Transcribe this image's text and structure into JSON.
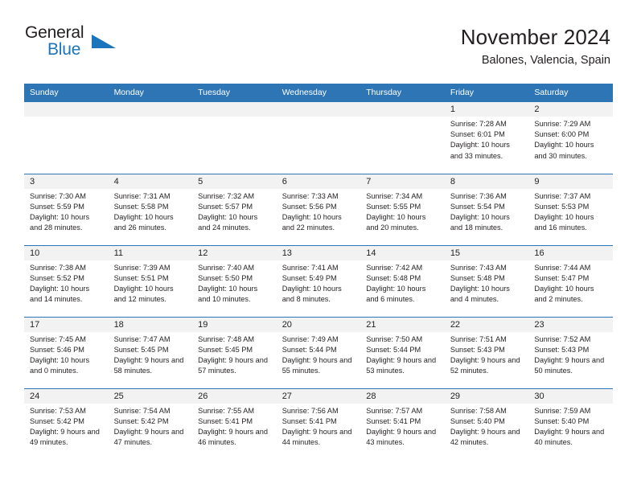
{
  "brand": {
    "name_top": "General",
    "name_bottom": "Blue",
    "accent_color": "#1c75bc",
    "triangle_icon": "triangle-icon"
  },
  "header": {
    "title": "November 2024",
    "location": "Balones, Valencia, Spain"
  },
  "theme": {
    "header_blue": "#2e75b6",
    "daynum_gray": "#f2f2f2",
    "text": "#231f20"
  },
  "weekday_headers": [
    "Sunday",
    "Monday",
    "Tuesday",
    "Wednesday",
    "Thursday",
    "Friday",
    "Saturday"
  ],
  "labels": {
    "sunrise": "Sunrise:",
    "sunset": "Sunset:",
    "daylight": "Daylight:"
  },
  "weeks": [
    [
      {
        "day": "",
        "blank": true
      },
      {
        "day": "",
        "blank": true
      },
      {
        "day": "",
        "blank": true
      },
      {
        "day": "",
        "blank": true
      },
      {
        "day": "",
        "blank": true
      },
      {
        "day": "1",
        "sunrise": "Sunrise: 7:28 AM",
        "sunset": "Sunset: 6:01 PM",
        "daylight": "Daylight: 10 hours and 33 minutes."
      },
      {
        "day": "2",
        "sunrise": "Sunrise: 7:29 AM",
        "sunset": "Sunset: 6:00 PM",
        "daylight": "Daylight: 10 hours and 30 minutes."
      }
    ],
    [
      {
        "day": "3",
        "sunrise": "Sunrise: 7:30 AM",
        "sunset": "Sunset: 5:59 PM",
        "daylight": "Daylight: 10 hours and 28 minutes."
      },
      {
        "day": "4",
        "sunrise": "Sunrise: 7:31 AM",
        "sunset": "Sunset: 5:58 PM",
        "daylight": "Daylight: 10 hours and 26 minutes."
      },
      {
        "day": "5",
        "sunrise": "Sunrise: 7:32 AM",
        "sunset": "Sunset: 5:57 PM",
        "daylight": "Daylight: 10 hours and 24 minutes."
      },
      {
        "day": "6",
        "sunrise": "Sunrise: 7:33 AM",
        "sunset": "Sunset: 5:56 PM",
        "daylight": "Daylight: 10 hours and 22 minutes."
      },
      {
        "day": "7",
        "sunrise": "Sunrise: 7:34 AM",
        "sunset": "Sunset: 5:55 PM",
        "daylight": "Daylight: 10 hours and 20 minutes."
      },
      {
        "day": "8",
        "sunrise": "Sunrise: 7:36 AM",
        "sunset": "Sunset: 5:54 PM",
        "daylight": "Daylight: 10 hours and 18 minutes."
      },
      {
        "day": "9",
        "sunrise": "Sunrise: 7:37 AM",
        "sunset": "Sunset: 5:53 PM",
        "daylight": "Daylight: 10 hours and 16 minutes."
      }
    ],
    [
      {
        "day": "10",
        "sunrise": "Sunrise: 7:38 AM",
        "sunset": "Sunset: 5:52 PM",
        "daylight": "Daylight: 10 hours and 14 minutes."
      },
      {
        "day": "11",
        "sunrise": "Sunrise: 7:39 AM",
        "sunset": "Sunset: 5:51 PM",
        "daylight": "Daylight: 10 hours and 12 minutes."
      },
      {
        "day": "12",
        "sunrise": "Sunrise: 7:40 AM",
        "sunset": "Sunset: 5:50 PM",
        "daylight": "Daylight: 10 hours and 10 minutes."
      },
      {
        "day": "13",
        "sunrise": "Sunrise: 7:41 AM",
        "sunset": "Sunset: 5:49 PM",
        "daylight": "Daylight: 10 hours and 8 minutes."
      },
      {
        "day": "14",
        "sunrise": "Sunrise: 7:42 AM",
        "sunset": "Sunset: 5:48 PM",
        "daylight": "Daylight: 10 hours and 6 minutes."
      },
      {
        "day": "15",
        "sunrise": "Sunrise: 7:43 AM",
        "sunset": "Sunset: 5:48 PM",
        "daylight": "Daylight: 10 hours and 4 minutes."
      },
      {
        "day": "16",
        "sunrise": "Sunrise: 7:44 AM",
        "sunset": "Sunset: 5:47 PM",
        "daylight": "Daylight: 10 hours and 2 minutes."
      }
    ],
    [
      {
        "day": "17",
        "sunrise": "Sunrise: 7:45 AM",
        "sunset": "Sunset: 5:46 PM",
        "daylight": "Daylight: 10 hours and 0 minutes."
      },
      {
        "day": "18",
        "sunrise": "Sunrise: 7:47 AM",
        "sunset": "Sunset: 5:45 PM",
        "daylight": "Daylight: 9 hours and 58 minutes."
      },
      {
        "day": "19",
        "sunrise": "Sunrise: 7:48 AM",
        "sunset": "Sunset: 5:45 PM",
        "daylight": "Daylight: 9 hours and 57 minutes."
      },
      {
        "day": "20",
        "sunrise": "Sunrise: 7:49 AM",
        "sunset": "Sunset: 5:44 PM",
        "daylight": "Daylight: 9 hours and 55 minutes."
      },
      {
        "day": "21",
        "sunrise": "Sunrise: 7:50 AM",
        "sunset": "Sunset: 5:44 PM",
        "daylight": "Daylight: 9 hours and 53 minutes."
      },
      {
        "day": "22",
        "sunrise": "Sunrise: 7:51 AM",
        "sunset": "Sunset: 5:43 PM",
        "daylight": "Daylight: 9 hours and 52 minutes."
      },
      {
        "day": "23",
        "sunrise": "Sunrise: 7:52 AM",
        "sunset": "Sunset: 5:43 PM",
        "daylight": "Daylight: 9 hours and 50 minutes."
      }
    ],
    [
      {
        "day": "24",
        "sunrise": "Sunrise: 7:53 AM",
        "sunset": "Sunset: 5:42 PM",
        "daylight": "Daylight: 9 hours and 49 minutes."
      },
      {
        "day": "25",
        "sunrise": "Sunrise: 7:54 AM",
        "sunset": "Sunset: 5:42 PM",
        "daylight": "Daylight: 9 hours and 47 minutes."
      },
      {
        "day": "26",
        "sunrise": "Sunrise: 7:55 AM",
        "sunset": "Sunset: 5:41 PM",
        "daylight": "Daylight: 9 hours and 46 minutes."
      },
      {
        "day": "27",
        "sunrise": "Sunrise: 7:56 AM",
        "sunset": "Sunset: 5:41 PM",
        "daylight": "Daylight: 9 hours and 44 minutes."
      },
      {
        "day": "28",
        "sunrise": "Sunrise: 7:57 AM",
        "sunset": "Sunset: 5:41 PM",
        "daylight": "Daylight: 9 hours and 43 minutes."
      },
      {
        "day": "29",
        "sunrise": "Sunrise: 7:58 AM",
        "sunset": "Sunset: 5:40 PM",
        "daylight": "Daylight: 9 hours and 42 minutes."
      },
      {
        "day": "30",
        "sunrise": "Sunrise: 7:59 AM",
        "sunset": "Sunset: 5:40 PM",
        "daylight": "Daylight: 9 hours and 40 minutes."
      }
    ]
  ]
}
